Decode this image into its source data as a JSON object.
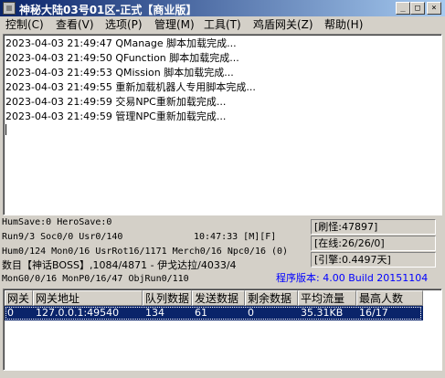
{
  "titlebar": {
    "title": "神秘大陆03号01区-正式【商业版】",
    "minimize_label": "_",
    "maximize_label": "□",
    "close_label": "×"
  },
  "menu": [
    {
      "label": "控制(C)"
    },
    {
      "label": "查看(V)"
    },
    {
      "label": "选项(P)"
    },
    {
      "label": "管理(M)"
    },
    {
      "label": "工具(T)"
    },
    {
      "label": "鸡盾网关(Z)"
    },
    {
      "label": "帮助(H)"
    }
  ],
  "log": [
    "2023-04-03 21:49:47 QManage 脚本加载完成...",
    "2023-04-03 21:49:50 QFunction 脚本加载完成...",
    "2023-04-03 21:49:53 QMission 脚本加载完成...",
    "2023-04-03 21:49:55 重新加载机器人专用脚本完成...",
    "2023-04-03 21:49:59 交易NPC重新加载完成...",
    "2023-04-03 21:49:59 管理NPC重新加载完成..."
  ],
  "status": {
    "line1": "HumSave:0 HeroSave:0",
    "line2": "Run9/3 Soc0/0 Usr0/140",
    "time": "10:47:33 [M][F]",
    "line3": "Hum0/124 Mon0/16 UsrRot16/1171 Merch0/16 Npc0/16 (0)",
    "line4": "数目【神话BOSS】,1084/4871 - 伊戈达拉/4033/4",
    "line5": "MonG0/0/16 MonP0/16/47 ObjRun0/110",
    "refresh": "[刷怪:47897]",
    "online": "[在线:26/26/0]",
    "reference": "[引擎:0.4497天]",
    "version": "程序版本: 4.00 Build 20151104"
  },
  "table": {
    "columns": [
      "网关",
      "网关地址",
      "队列数据",
      "发送数据",
      "剩余数据",
      "平均流量",
      "最高人数"
    ],
    "rows": [
      [
        "0",
        "127.0.0.1:49540",
        "134",
        "61",
        "0",
        "35.31KB",
        "16/17"
      ]
    ]
  }
}
